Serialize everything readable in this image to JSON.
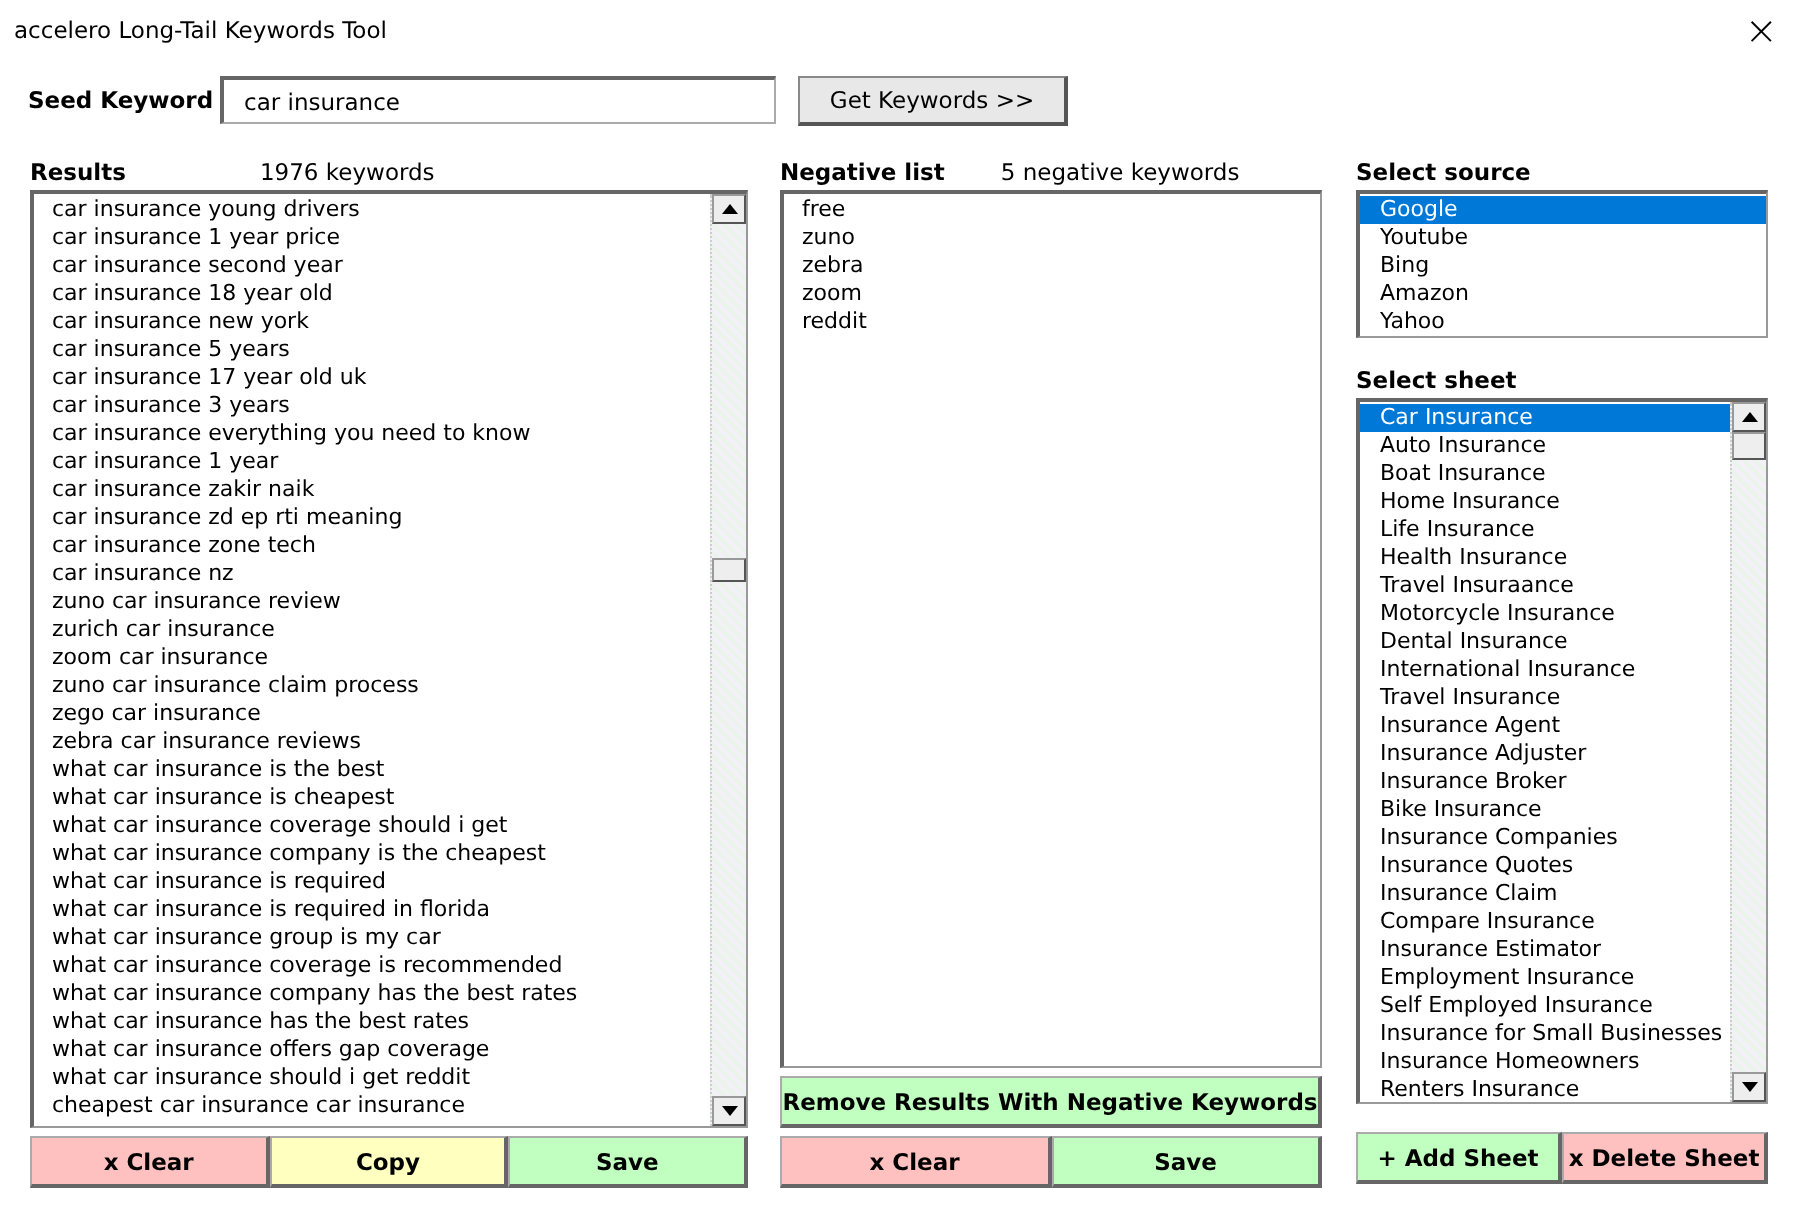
{
  "window": {
    "title": "accelero Long-Tail Keywords Tool",
    "close": "×"
  },
  "seed": {
    "label": "Seed Keyword",
    "value": "car insurance",
    "button": "Get Keywords >>"
  },
  "results": {
    "title": "Results",
    "count": "1976 keywords",
    "items": [
      "car insurance young drivers",
      "car insurance 1 year price",
      "car insurance second year",
      "car insurance 18 year old",
      "car insurance new york",
      "car insurance 5 years",
      "car insurance 17 year old uk",
      "car insurance 3 years",
      "car insurance everything you need to know",
      "car insurance 1 year",
      "car insurance zakir naik",
      "car insurance zd ep rti meaning",
      "car insurance zone tech",
      "car insurance nz",
      "zuno car insurance review",
      "zurich car insurance",
      "zoom car insurance",
      "zuno car insurance claim process",
      "zego car insurance",
      "zebra car insurance reviews",
      "what car insurance is the best",
      "what car insurance is cheapest",
      "what car insurance coverage should i get",
      "what car insurance company is the cheapest",
      "what car insurance is required",
      "what car insurance is required in florida",
      "what car insurance group is my car",
      "what car insurance coverage is recommended",
      "what car insurance company has the best rates",
      "what car insurance has the best rates",
      "what car insurance offers gap coverage",
      "what car insurance should i get reddit",
      "cheapest car insurance car insurance"
    ],
    "buttons": [
      {
        "label": "x Clear",
        "color": "#ffc0c0"
      },
      {
        "label": "Copy",
        "color": "#ffffc0"
      },
      {
        "label": "Save",
        "color": "#c0ffc0"
      }
    ]
  },
  "negative": {
    "title": "Negative list",
    "count": "5 negative keywords",
    "items": [
      "free",
      "zuno",
      "zebra",
      "zoom",
      "reddit"
    ],
    "remove_button": "Remove Results With Negative Keywords",
    "buttons": [
      {
        "label": "x Clear",
        "color": "#ffc0c0"
      },
      {
        "label": "Save",
        "color": "#c0ffc0"
      }
    ]
  },
  "source": {
    "title": "Select source",
    "items": [
      {
        "label": "Google",
        "selected": true
      },
      {
        "label": "Youtube",
        "selected": false
      },
      {
        "label": "Bing",
        "selected": false
      },
      {
        "label": "Amazon",
        "selected": false
      },
      {
        "label": "Yahoo",
        "selected": false
      }
    ]
  },
  "sheet": {
    "title": "Select sheet",
    "items": [
      {
        "label": "Car Insurance",
        "selected": true
      },
      {
        "label": "Auto Insurance",
        "selected": false
      },
      {
        "label": "Boat Insurance",
        "selected": false
      },
      {
        "label": "Home Insurance",
        "selected": false
      },
      {
        "label": "Life Insurance",
        "selected": false
      },
      {
        "label": "Health Insurance",
        "selected": false
      },
      {
        "label": "Travel Insuraance",
        "selected": false
      },
      {
        "label": "Motorcycle Insurance",
        "selected": false
      },
      {
        "label": "Dental Insurance",
        "selected": false
      },
      {
        "label": "International Insurance",
        "selected": false
      },
      {
        "label": "Travel Insurance",
        "selected": false
      },
      {
        "label": "Insurance Agent",
        "selected": false
      },
      {
        "label": "Insurance Adjuster",
        "selected": false
      },
      {
        "label": "Insurance Broker",
        "selected": false
      },
      {
        "label": "Bike Insurance",
        "selected": false
      },
      {
        "label": "Insurance Companies",
        "selected": false
      },
      {
        "label": "Insurance Quotes",
        "selected": false
      },
      {
        "label": "Insurance Claim",
        "selected": false
      },
      {
        "label": "Compare Insurance",
        "selected": false
      },
      {
        "label": "Insurance Estimator",
        "selected": false
      },
      {
        "label": "Employment Insurance",
        "selected": false
      },
      {
        "label": "Self Employed Insurance",
        "selected": false
      },
      {
        "label": "Insurance for Small Businesses",
        "selected": false
      },
      {
        "label": "Insurance Homeowners",
        "selected": false
      },
      {
        "label": "Renters Insurance",
        "selected": false
      }
    ],
    "buttons": [
      {
        "label": "+ Add Sheet",
        "color": "#c0ffc0"
      },
      {
        "label": "x Delete Sheet",
        "color": "#ffc0c0"
      }
    ]
  }
}
